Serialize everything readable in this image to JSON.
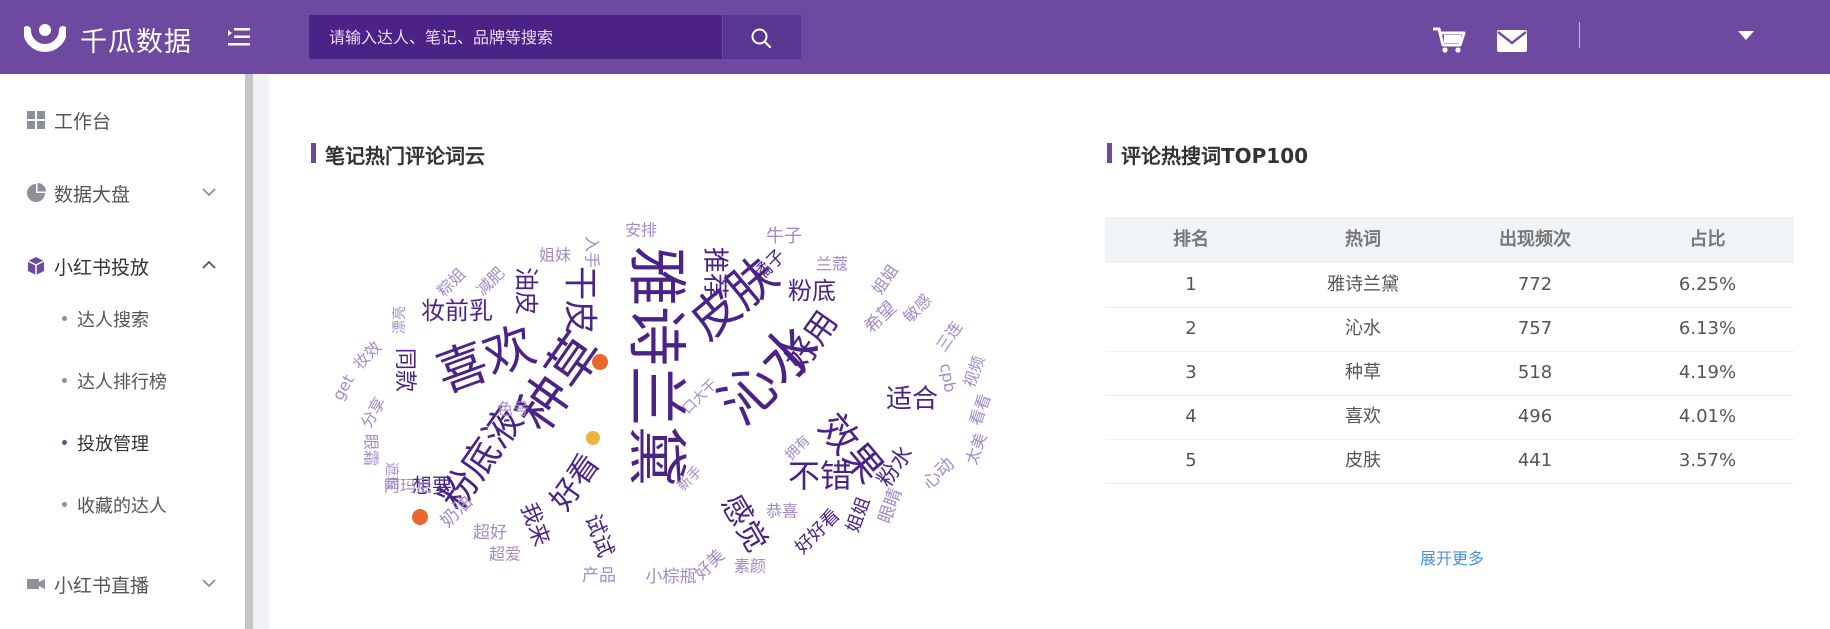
{
  "header": {
    "brand": "千瓜数据",
    "search_placeholder": "请输入达人、笔记、品牌等搜索"
  },
  "sidebar": {
    "items": [
      {
        "label": "工作台"
      },
      {
        "label": "数据大盘"
      },
      {
        "label": "小红书投放"
      },
      {
        "label": "小红书直播"
      }
    ],
    "subitems": [
      {
        "label": "达人搜索"
      },
      {
        "label": "达人排行榜"
      },
      {
        "label": "投放管理"
      },
      {
        "label": "收藏的达人"
      }
    ]
  },
  "wordcloud": {
    "title": "笔记热门评论词云",
    "words": [
      "雅诗兰黛",
      "沁水",
      "种草",
      "喜欢",
      "皮肤",
      "粉底液",
      "效果",
      "干皮",
      "好用",
      "不错",
      "感觉",
      "好看",
      "适合",
      "推荐",
      "粉底",
      "妆前乳",
      "油皮",
      "试试",
      "我来",
      "同款",
      "想要",
      "奶油",
      "超好",
      "超爱",
      "产品",
      "小棕瓶",
      "好美",
      "素颜",
      "恭喜",
      "好好看",
      "姐姐",
      "粉水",
      "眼睛",
      "心动",
      "太美",
      "看看",
      "视频",
      "cpb",
      "三连",
      "敏感",
      "姐姐",
      "希望",
      "兰蔻",
      "橘子",
      "牛子",
      "安排",
      "入手",
      "姐妹",
      "减肥",
      "粽姐",
      "漂亮",
      "妆效",
      "get",
      "分享",
      "阿玛尼",
      "色号",
      "眼霜",
      "遮瑕",
      "口大干",
      "拥有",
      "新手",
      "状态",
      "妆容"
    ]
  },
  "top100": {
    "title": "评论热搜词TOP100",
    "columns": [
      "排名",
      "热词",
      "出现频次",
      "占比"
    ],
    "rows": [
      [
        "1",
        "雅诗兰黛",
        "772",
        "6.25%"
      ],
      [
        "2",
        "沁水",
        "757",
        "6.13%"
      ],
      [
        "3",
        "种草",
        "518",
        "4.19%"
      ],
      [
        "4",
        "喜欢",
        "496",
        "4.01%"
      ],
      [
        "5",
        "皮肤",
        "441",
        "3.57%"
      ]
    ],
    "more": "展开更多"
  },
  "colors": {
    "brand": "#6d4aa0",
    "word_dark": "#4b2386",
    "word_light": "#a48bc6"
  }
}
